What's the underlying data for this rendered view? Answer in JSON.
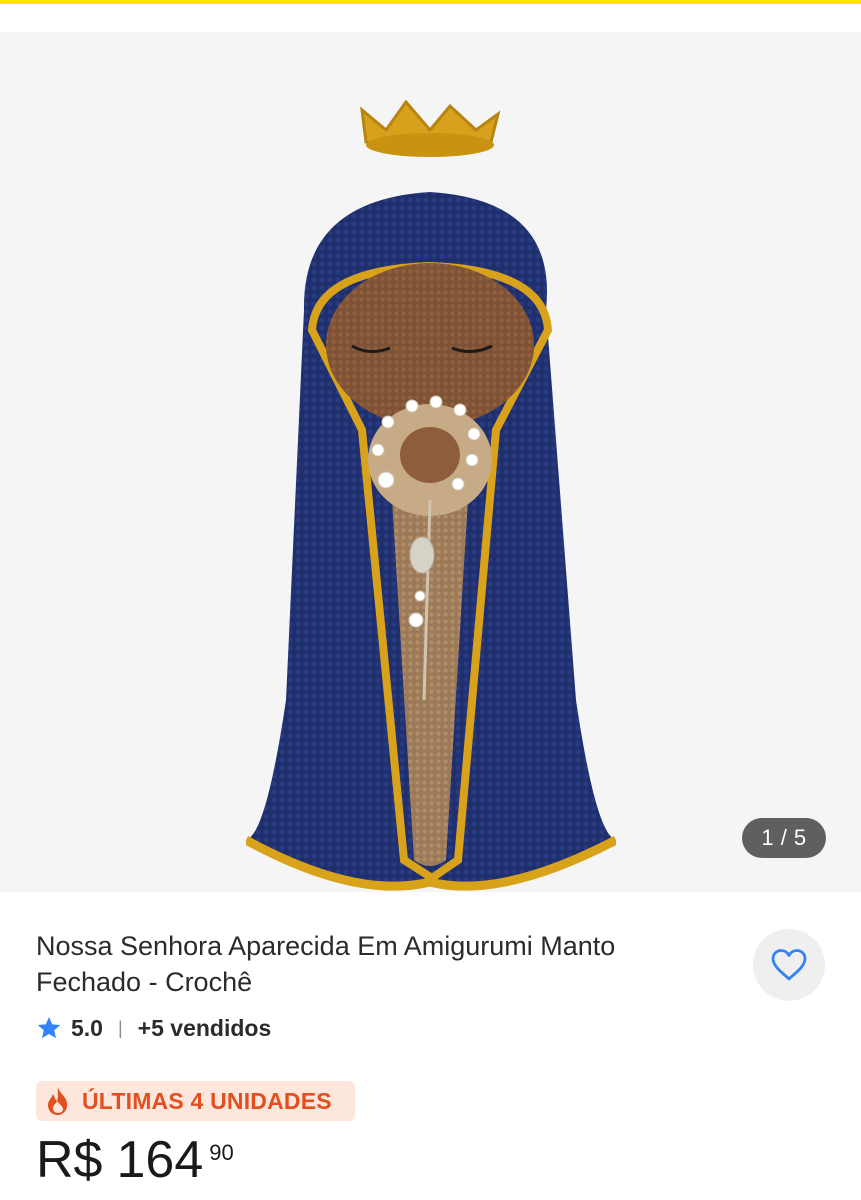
{
  "colors": {
    "accent": "#ffe600",
    "star": "#3483fa",
    "heart": "#3483fa",
    "badge_bg": "#fde6dc",
    "badge_text": "#e1501e",
    "mantle_blue": "#1e2f6e",
    "gold_trim": "#d9a21b",
    "face_brown": "#8a5a3b"
  },
  "gallery": {
    "image_alt": "Nossa Senhora Aparecida crochet figure",
    "pager_text": "1 / 5"
  },
  "product": {
    "title": "Nossa Senhora Aparecida Em Amigurumi Manto Fechado - Crochê",
    "rating": "5.0",
    "rating_separator": "|",
    "sold": "+5 vendidos",
    "badge": "ÚLTIMAS 4 UNIDADES",
    "price_currency": "R$",
    "price_amount": "164",
    "price_cents": "90"
  },
  "icons": {
    "favorite": "heart-icon",
    "rating": "star-icon",
    "badge": "flame-icon"
  }
}
